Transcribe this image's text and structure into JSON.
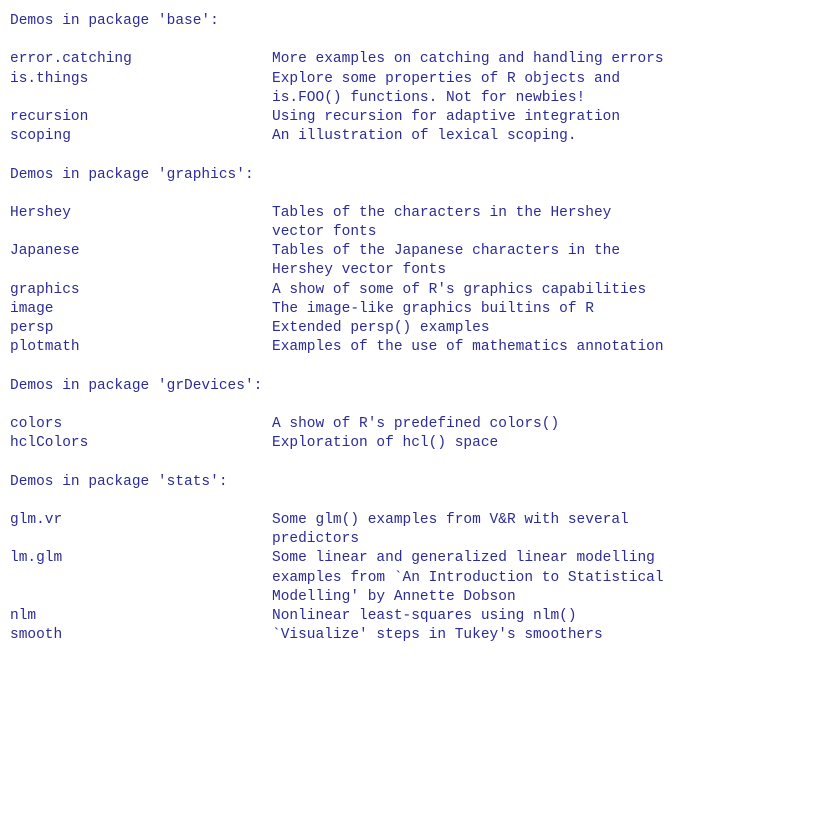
{
  "terminal": {
    "text_color": "#2c2c96",
    "background_color": "#ffffff"
  },
  "packages": [
    {
      "header": "Demos in package 'base':",
      "demos": [
        {
          "name": "error.catching",
          "description_lines": [
            "More examples on catching and handling errors"
          ]
        },
        {
          "name": "is.things",
          "description_lines": [
            "Explore some properties of R objects and",
            "is.FOO() functions. Not for newbies!"
          ]
        },
        {
          "name": "recursion",
          "description_lines": [
            "Using recursion for adaptive integration"
          ]
        },
        {
          "name": "scoping",
          "description_lines": [
            "An illustration of lexical scoping."
          ]
        }
      ]
    },
    {
      "header": "Demos in package 'graphics':",
      "demos": [
        {
          "name": "Hershey",
          "description_lines": [
            "Tables of the characters in the Hershey",
            "vector fonts"
          ]
        },
        {
          "name": "Japanese",
          "description_lines": [
            "Tables of the Japanese characters in the",
            "Hershey vector fonts"
          ]
        },
        {
          "name": "graphics",
          "description_lines": [
            "A show of some of R's graphics capabilities"
          ]
        },
        {
          "name": "image",
          "description_lines": [
            "The image-like graphics builtins of R"
          ]
        },
        {
          "name": "persp",
          "description_lines": [
            "Extended persp() examples"
          ]
        },
        {
          "name": "plotmath",
          "description_lines": [
            "Examples of the use of mathematics annotation"
          ]
        }
      ]
    },
    {
      "header": "Demos in package 'grDevices':",
      "demos": [
        {
          "name": "colors",
          "description_lines": [
            "A show of R's predefined colors()"
          ]
        },
        {
          "name": "hclColors",
          "description_lines": [
            "Exploration of hcl() space"
          ]
        }
      ]
    },
    {
      "header": "Demos in package 'stats':",
      "demos": [
        {
          "name": "glm.vr",
          "description_lines": [
            "Some glm() examples from V&R with several",
            "predictors"
          ]
        },
        {
          "name": "lm.glm",
          "description_lines": [
            "Some linear and generalized linear modelling",
            "examples from `An Introduction to Statistical",
            "Modelling' by Annette Dobson"
          ]
        },
        {
          "name": "nlm",
          "description_lines": [
            "Nonlinear least-squares using nlm()"
          ]
        },
        {
          "name": "smooth",
          "description_lines": [
            "`Visualize' steps in Tukey's smoothers"
          ]
        }
      ]
    }
  ]
}
